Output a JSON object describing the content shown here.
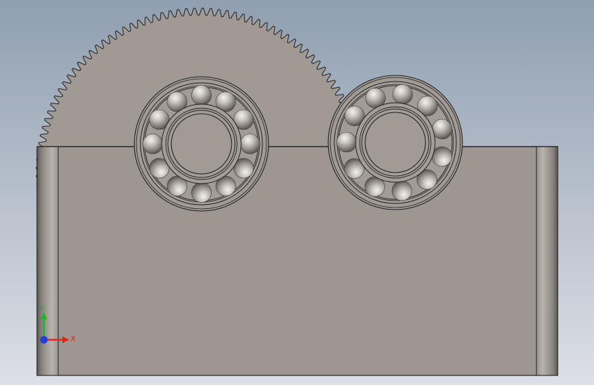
{
  "viewport": {
    "background_top": "#8f9fb1",
    "background_bottom": "#dde0e6"
  },
  "model": {
    "gear": {
      "teeth": 124,
      "color": "#a19993"
    },
    "housing": {
      "color": "#9e9690",
      "edge_color": "#1d1d1d"
    },
    "bearings": [
      {
        "name": "left-bearing",
        "balls": 12
      },
      {
        "name": "right-bearing",
        "balls": 11
      }
    ],
    "colors": {
      "ball_light": "#f4f2ef",
      "ball_mid": "#a8a19b",
      "ball_dark": "#4e4944",
      "outline": "#1e1e1e"
    }
  },
  "triad": {
    "x_label": "X",
    "y_label": "Y",
    "x_color": "#e0241b",
    "y_color": "#1fb32a",
    "z_color": "#1f3fd8"
  }
}
